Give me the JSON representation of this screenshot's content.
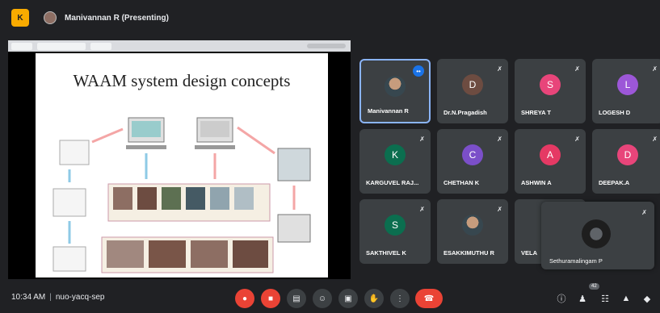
{
  "topbar": {
    "presenter_title": "Manivannan R (Presenting)",
    "app_logo": "K"
  },
  "slide": {
    "title": "WAAM system design concepts"
  },
  "tiles": [
    {
      "name": "Manivannan R",
      "initial": "",
      "color": "#3c4043",
      "photo": true,
      "speaking": true
    },
    {
      "name": "Dr.N.Pragadish",
      "initial": "D",
      "color": "#6d4c41"
    },
    {
      "name": "SHREYA T",
      "initial": "S",
      "color": "#e8457a"
    },
    {
      "name": "LOGESH D",
      "initial": "L",
      "color": "#9c57d8"
    },
    {
      "name": "KARGUVEL RAJ...",
      "initial": "K",
      "color": "#0b6e4f"
    },
    {
      "name": "CHETHAN K",
      "initial": "C",
      "color": "#7b4fc9"
    },
    {
      "name": "ASHWIN A",
      "initial": "A",
      "color": "#e53964"
    },
    {
      "name": "DEEPAK.A",
      "initial": "D",
      "color": "#e8457a"
    },
    {
      "name": "SAKTHIVEL K",
      "initial": "S",
      "color": "#0b6e4f"
    },
    {
      "name": "ESAKKIMUTHU R",
      "initial": "",
      "color": "#3c4043",
      "photo": true
    },
    {
      "name": "VELA",
      "initial": "",
      "color": "#3c4043"
    }
  ],
  "overlay_tile": {
    "name": "Sethuramalingam P"
  },
  "bottombar": {
    "time": "10:34 AM",
    "meeting_code": "nuo-yacq-sep",
    "participants_badge": "42"
  },
  "icons": {
    "mic_off": "mic-off-icon",
    "speaking": "audio-wave-icon",
    "controls": [
      "mic-off-icon",
      "camera-off-icon",
      "captions-icon",
      "emoji-icon",
      "present-icon",
      "raise-hand-icon",
      "more-options-icon",
      "end-call-icon"
    ],
    "right_controls": [
      "info-icon",
      "people-icon",
      "chat-icon",
      "activities-icon",
      "host-controls-icon"
    ]
  },
  "colors": {
    "background": "#202124",
    "tile": "#3c4043",
    "danger": "#ea4335",
    "accent": "#8ab4f8"
  }
}
